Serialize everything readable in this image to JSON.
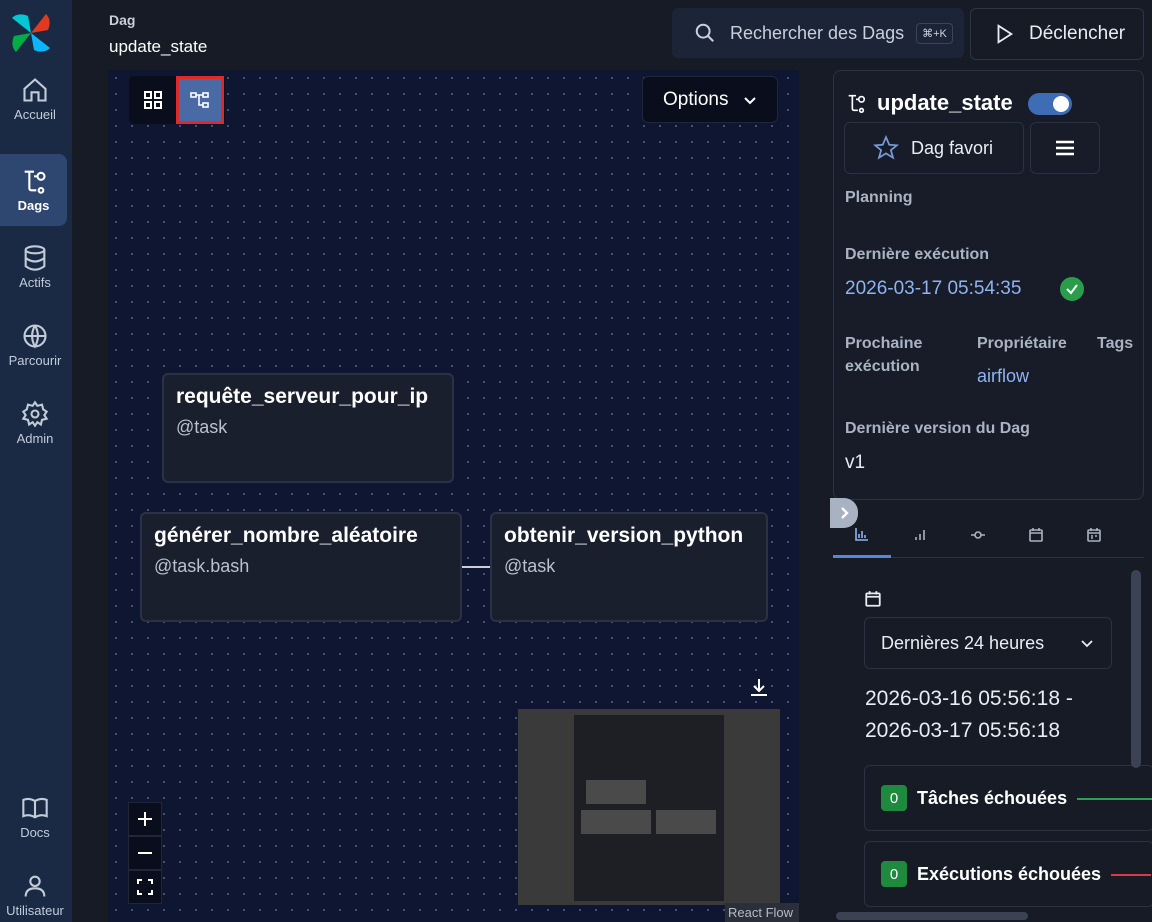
{
  "nav": {
    "items": [
      {
        "label": "Accueil",
        "icon": "home-icon"
      },
      {
        "label": "Dags",
        "icon": "dag-icon",
        "active": true
      },
      {
        "label": "Actifs",
        "icon": "database-icon"
      },
      {
        "label": "Parcourir",
        "icon": "globe-icon"
      },
      {
        "label": "Admin",
        "icon": "gear-icon"
      }
    ],
    "bottom": [
      {
        "label": "Docs",
        "icon": "book-icon"
      },
      {
        "label": "Utilisateur",
        "icon": "user-icon"
      }
    ]
  },
  "header": {
    "section": "Dag",
    "dag_id": "update_state",
    "search_placeholder": "Rechercher des Dags",
    "search_shortcut": "⌘+K",
    "trigger_label": "Déclencher"
  },
  "graph": {
    "options_label": "Options",
    "tasks": [
      {
        "name": "requête_serveur_pour_ip",
        "operator": "@task"
      },
      {
        "name": "générer_nombre_aléatoire",
        "operator": "@task.bash"
      },
      {
        "name": "obtenir_version_python",
        "operator": "@task"
      }
    ],
    "react_flow_label": "React Flow"
  },
  "details": {
    "title": "update_state",
    "paused": false,
    "favorite_label": "Dag favori",
    "planning_label": "Planning",
    "last_run_label": "Dernière exécution",
    "last_run_value": "2026-03-17 05:54:35",
    "next_run_label_1": "Prochaine",
    "next_run_label_2": "exécution",
    "owner_label": "Propriétaire",
    "owner_value": "airflow",
    "tags_label": "Tags",
    "version_label": "Dernière version du Dag",
    "version_value": "v1"
  },
  "overview": {
    "range_select": "Dernières 24 heures",
    "range_start": "2026-03-16 05:56:18 -",
    "range_end": "2026-03-17 05:56:18",
    "stats": [
      {
        "count": "0",
        "label": "Tâches échouées",
        "color": "#2ea04f"
      },
      {
        "count": "0",
        "label": "Exécutions échouées",
        "color": "#d73a49"
      }
    ]
  },
  "colors": {
    "accent": "#4a6aa6",
    "success": "#2a9d4b",
    "highlight_border": "#e02a2a"
  }
}
